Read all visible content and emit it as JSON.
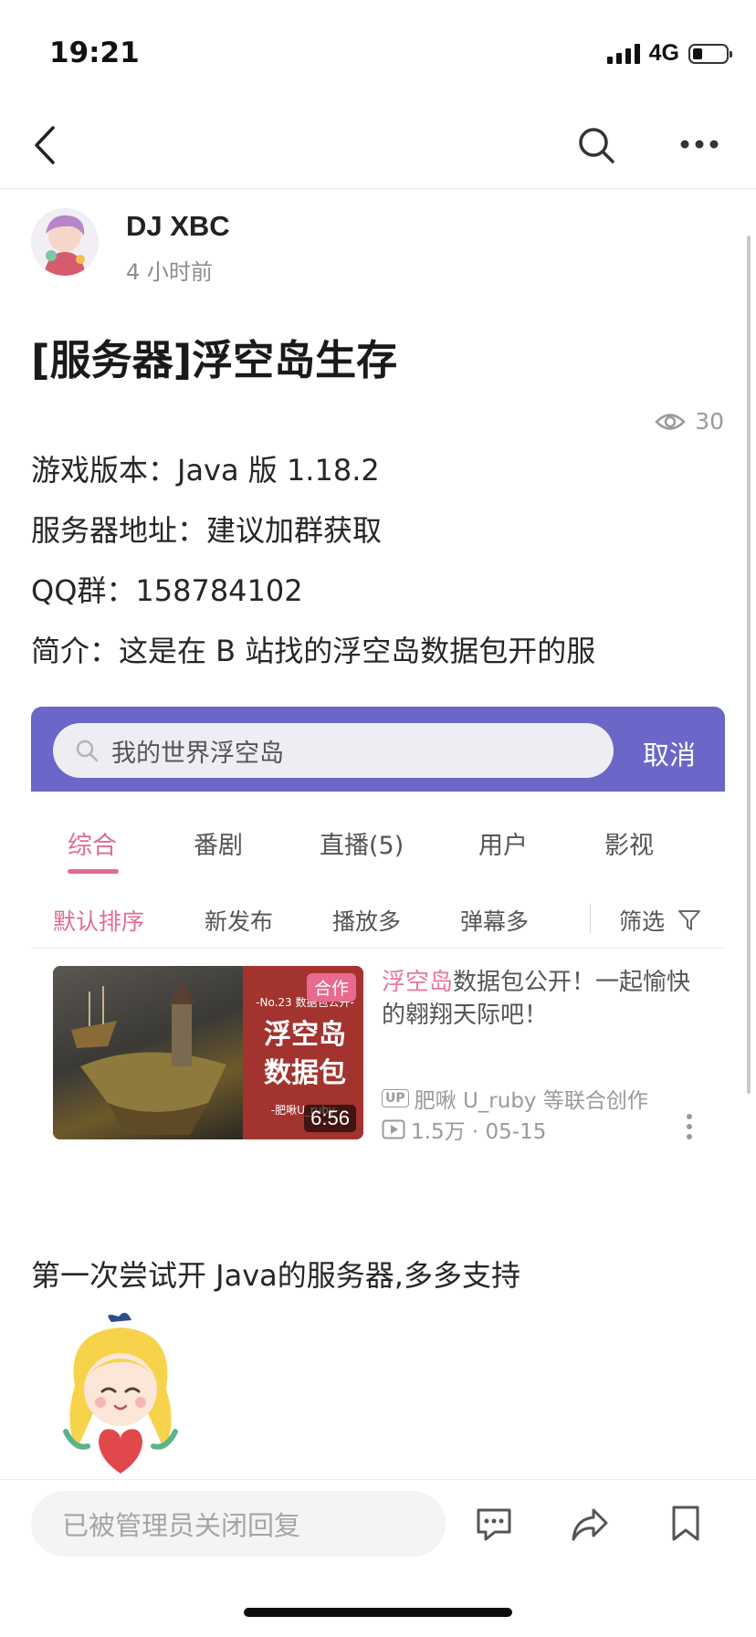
{
  "status_bar": {
    "time": "19:21",
    "network": "4G"
  },
  "post": {
    "author": "DJ XBC",
    "time_ago": "4 小时前",
    "title": "[服务器]浮空岛生存",
    "views": "30",
    "lines": [
      "游戏版本：Java 版 1.18.2",
      "服务器地址：建议加群获取",
      "QQ群：158784102",
      "简介：这是在 B 站找的浮空岛数据包开的服"
    ],
    "closing": "第一次尝试开 Java的服务器,多多支持"
  },
  "embed": {
    "search_text": "我的世界浮空岛",
    "cancel": "取消",
    "tabs": [
      "综合",
      "番剧",
      "直播(5)",
      "用户",
      "影视"
    ],
    "sorts": [
      "默认排序",
      "新发布",
      "播放多",
      "弹幕多",
      "筛选"
    ],
    "video": {
      "title_highlight": "浮空岛",
      "title_rest": "数据包公开！一起愉快的翱翔天际吧！",
      "thumb_top": "-No.23 数据包公开-",
      "thumb_line1": "浮空岛",
      "thumb_line2": "数据包",
      "thumb_bottom": "-肥啾U_ruby-",
      "badge": "合作",
      "duration": "6:56",
      "up_label": "UP",
      "uploader": "肥啾 U_ruby 等联合创作",
      "stats": "1.5万 · 05-15"
    }
  },
  "bottom": {
    "reply_placeholder": "已被管理员关闭回复"
  },
  "colors": {
    "accent": "#e16b94",
    "header_purple": "#6a67c9"
  }
}
